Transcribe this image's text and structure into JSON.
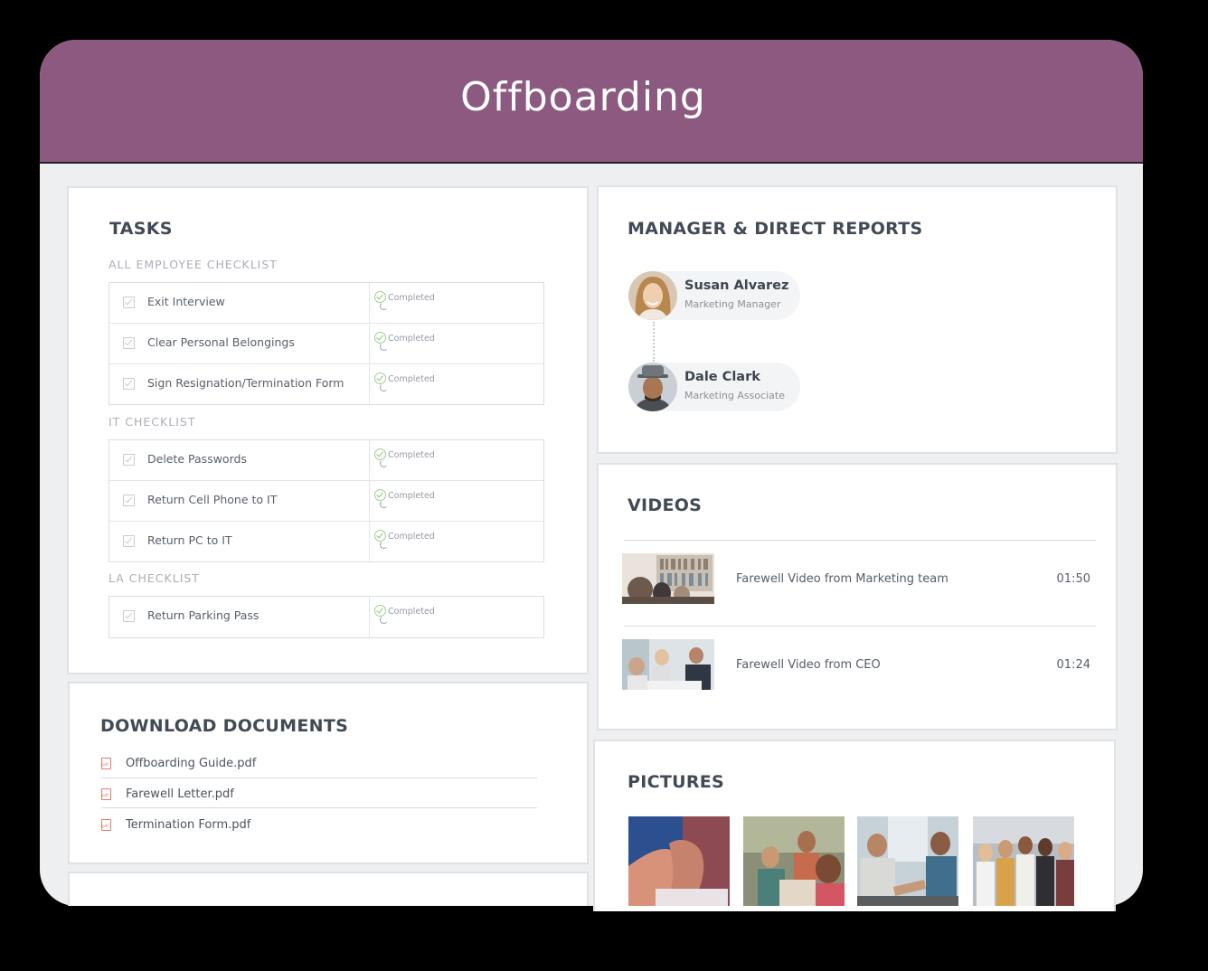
{
  "header": {
    "title": "Offboarding"
  },
  "tasks": {
    "title": "TASKS",
    "groups": [
      {
        "heading": "ALL EMPLOYEE CHECKLIST",
        "items": [
          {
            "label": "Exit Interview",
            "status": "Completed"
          },
          {
            "label": "Clear Personal Belongings",
            "status": "Completed"
          },
          {
            "label": "Sign Resignation/Termination Form",
            "status": "Completed"
          }
        ]
      },
      {
        "heading": "IT CHECKLIST",
        "items": [
          {
            "label": "Delete Passwords",
            "status": "Completed"
          },
          {
            "label": "Return Cell Phone to IT",
            "status": "Completed"
          },
          {
            "label": "Return PC to IT",
            "status": "Completed"
          }
        ]
      },
      {
        "heading": "LA CHECKLIST",
        "items": [
          {
            "label": "Return Parking Pass",
            "status": "Completed"
          }
        ]
      }
    ]
  },
  "documents": {
    "title": "DOWNLOAD DOCUMENTS",
    "files": [
      {
        "name": "Offboarding Guide.pdf",
        "icon": "pdf-icon"
      },
      {
        "name": "Farewell Letter.pdf",
        "icon": "pdf-icon"
      },
      {
        "name": "Termination Form.pdf",
        "icon": "pdf-icon"
      }
    ]
  },
  "manager": {
    "title": "MANAGER & DIRECT REPORTS",
    "people": [
      {
        "name": "Susan Alvarez",
        "role": "Marketing Manager"
      },
      {
        "name": "Dale Clark",
        "role": "Marketing Associate"
      }
    ]
  },
  "videos": {
    "title": "VIDEOS",
    "items": [
      {
        "title": "Farewell Video from Marketing team",
        "duration": "01:50"
      },
      {
        "title": "Farewell Video from CEO",
        "duration": "01:24"
      }
    ]
  },
  "pictures": {
    "title": "PICTURES",
    "count": 4
  },
  "colors": {
    "header": "#8c5a80",
    "completed": "#8bc47b",
    "pdf": "#e07a6a"
  }
}
